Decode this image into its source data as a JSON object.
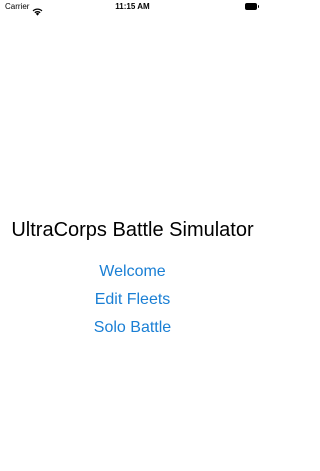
{
  "status_bar": {
    "carrier": "Carrier",
    "time": "11:15 AM",
    "wifi_icon": "wifi-icon",
    "battery_icon": "battery-icon"
  },
  "main": {
    "title": "UltraCorps Battle Simulator",
    "menu": [
      {
        "label": "Welcome"
      },
      {
        "label": "Edit Fleets"
      },
      {
        "label": "Solo Battle"
      }
    ]
  },
  "colors": {
    "background": "#ffffff",
    "text": "#000000",
    "link": "#1a7fd4"
  }
}
